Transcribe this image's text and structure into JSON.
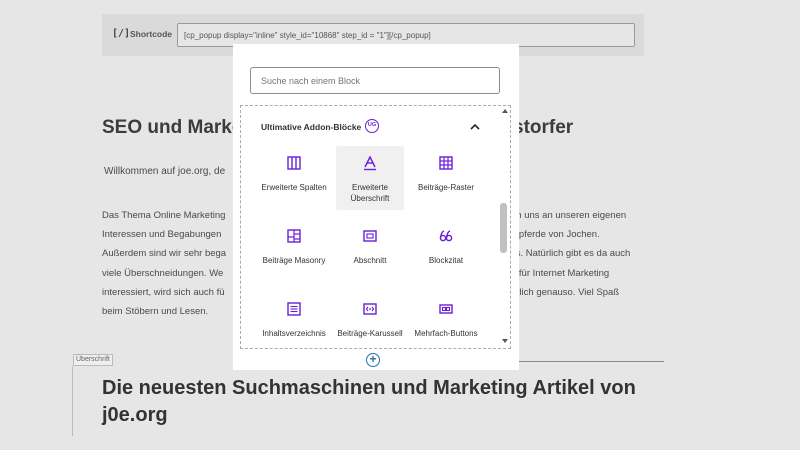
{
  "shortcode": {
    "icon": "shortcode-icon",
    "icon_text": "[/]",
    "label": "Shortcode",
    "value": "[cp_popup display=\"inline\" style_id=\"10868\" step_id = \"1\"][/cp_popup]"
  },
  "content": {
    "heading_left": "SEO und Marke",
    "heading_right": "storfer",
    "welcome": "Willkommen auf joe.org, de",
    "para_left": [
      "Das Thema Online Marketing",
      "Interessen und Begabungen",
      "Außerdem sind wir sehr bega",
      "viele Überschneidungen. We",
      "interessiert, wird sich auch fü",
      "beim Stöbern und Lesen."
    ],
    "para_right": [
      "en uns an unseren eigenen",
      "mpferde von Jochen.",
      "ss. Natürlich gibt es da auch",
      "h für Internet Marketing",
      "ürlich genauso. Viel Spaß",
      ""
    ],
    "block_tag": "Überschrift",
    "big_heading": "Die neuesten Suchmaschinen und Marketing Artikel von j0e.org"
  },
  "inserter": {
    "search_placeholder": "Suche nach einem Block",
    "category": {
      "title": "Ultimative Addon-Blöcke",
      "badge": "UG",
      "chevron": "chevron-up-icon"
    },
    "blocks": [
      {
        "label": "Erweiterte Spalten",
        "icon": "columns-icon",
        "active": false
      },
      {
        "label": "Erweiterte Überschrift",
        "icon": "heading-icon",
        "active": true
      },
      {
        "label": "Beiträge-Raster",
        "icon": "grid-icon",
        "active": false
      },
      {
        "label": "Beiträge Masonry",
        "icon": "masonry-icon",
        "active": false
      },
      {
        "label": "Abschnitt",
        "icon": "section-icon",
        "active": false
      },
      {
        "label": "Blockzitat",
        "icon": "quote-icon",
        "active": false
      },
      {
        "label": "Inhaltsverzeichnis",
        "icon": "toc-icon",
        "active": false
      },
      {
        "label": "Beiträge-Karussell",
        "icon": "carousel-icon",
        "active": false
      },
      {
        "label": "Mehrfach-Buttons",
        "icon": "buttons-icon",
        "active": false
      }
    ]
  },
  "colors": {
    "accent": "#6a1ed8",
    "inserter_blue": "#1e75a8"
  }
}
